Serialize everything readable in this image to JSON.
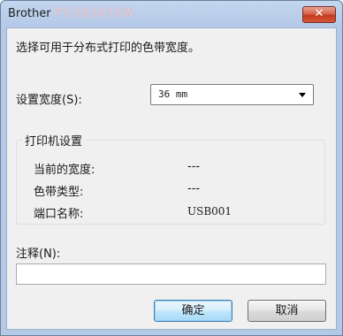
{
  "window": {
    "title": "Brother",
    "title_redacted": "PT-E850TKW"
  },
  "dialog": {
    "instruction": "选择可用于分布式打印的色带宽度。",
    "width_label": "设置宽度(S):",
    "width_value": "36 mm",
    "printer_settings": {
      "group_title": "打印机设置",
      "rows": [
        {
          "label": "当前的宽度:",
          "value": "---"
        },
        {
          "label": "色带类型:",
          "value": "---"
        },
        {
          "label": "端口名称:",
          "value": "USB001"
        }
      ]
    },
    "note_label": "注释(N):",
    "note_value": "",
    "ok_label": "确定",
    "cancel_label": "取消"
  },
  "colors": {
    "frame": "#b4c9e6",
    "client_background": "#f0f0f0",
    "close_button": "#c3391f",
    "default_button_border": "#3c7fb1"
  },
  "icons": {
    "close": "close-icon",
    "dropdown": "chevron-down-icon"
  }
}
